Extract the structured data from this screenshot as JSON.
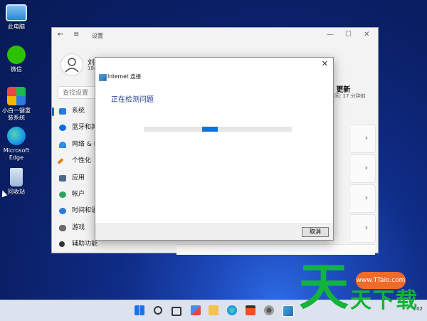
{
  "desktop": {
    "icons": [
      {
        "label": "此电脑",
        "color": "#3a8fd8"
      },
      {
        "label": "微信",
        "color": "#2dc100"
      },
      {
        "label": "小白一键重装系统",
        "color": "#2b7be0"
      },
      {
        "label": "Microsoft Edge",
        "color": "#1e9be8"
      },
      {
        "label": "回收站",
        "color": "#9fb7d6"
      }
    ]
  },
  "settings": {
    "title": "设置",
    "back_icon": "←",
    "menu_icon": "≡",
    "minimize": "—",
    "maximize": "☐",
    "close": "✕",
    "user_name": "刘",
    "user_sub": "184",
    "search_placeholder": "查找设置",
    "nav": [
      {
        "label": "系统",
        "color": "#2a7bd6",
        "active": true
      },
      {
        "label": "蓝牙和其",
        "color": "#0a6fd6"
      },
      {
        "label": "网络 & In",
        "color": "#2f8de6"
      },
      {
        "label": "个性化",
        "color": "#d8801f"
      },
      {
        "label": "应用",
        "color": "#4c6a8c"
      },
      {
        "label": "帐户",
        "color": "#2aa35b"
      },
      {
        "label": "时间和语",
        "color": "#2a7bd6"
      },
      {
        "label": "游戏",
        "color": "#6a6a6a"
      },
      {
        "label": "辅助功能",
        "color": "#333333"
      }
    ],
    "update_title": "s 更新",
    "update_sub": "时间: 17 分钟前",
    "chevron": "›"
  },
  "dialog": {
    "title": "Internet 连接",
    "close": "✕",
    "heading": "正在检测问题",
    "progress": 0.5,
    "cancel_label": "取消"
  },
  "taskbar": {
    "clock": "202"
  },
  "watermark": {
    "chars": [
      "天",
      "天",
      "下",
      "载"
    ],
    "url": "www.TTaio.com"
  }
}
